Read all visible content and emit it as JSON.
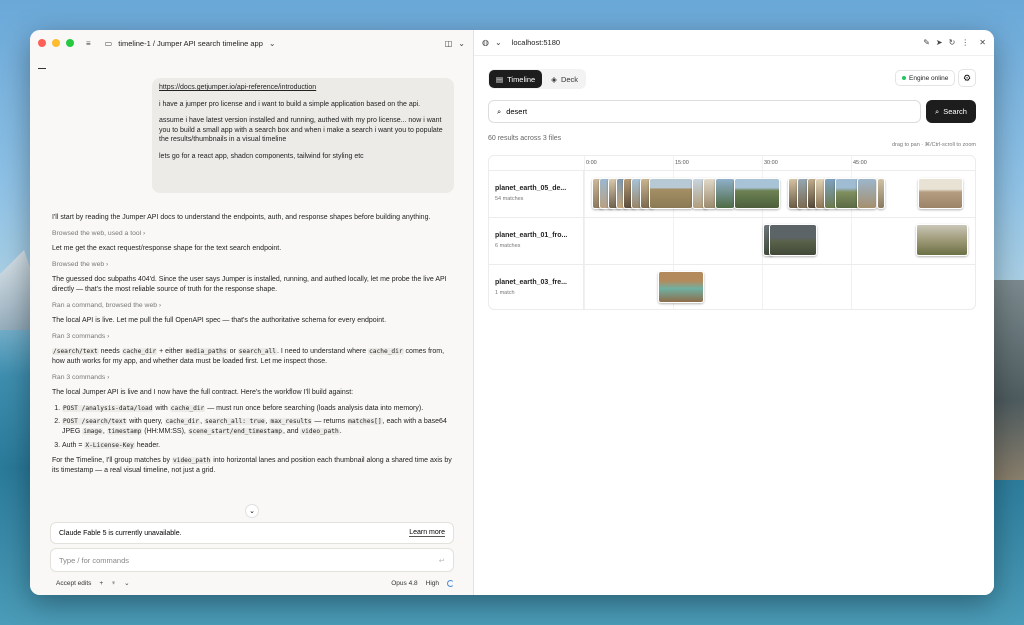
{
  "left": {
    "title": "timeline-1 / Jumper API search timeline app",
    "user_message": {
      "link": "https://docs.getjumper.io/api-reference/introduction",
      "p1": "i have a jumper pro license and i want to build a simple application based on the api.",
      "p2": "assume i have latest version installed and running, authed with my pro license... now i want you to build a small app with a search box and when i make a search i want you to populate the results/thumbnails in a visual timeline",
      "p3": "lets go for a react app, shadcn components, tailwind for styling etc"
    },
    "conversation": {
      "msg1": "I'll start by reading the Jumper API docs to understand the endpoints, auth, and response shapes before building anything.",
      "act1": "Browsed the web, used a tool",
      "msg2": "Let me get the exact request/response shape for the text search endpoint.",
      "act2": "Browsed the web",
      "msg3": "The guessed doc subpaths 404'd. Since the user says Jumper is installed, running, and authed locally, let me probe the live API directly — that's the most reliable source of truth for the response shape.",
      "act3": "Ran a command, browsed the web",
      "msg4": "The local API is live. Let me pull the full OpenAPI spec — that's the authoritative schema for every endpoint.",
      "act4": "Ran 3 commands",
      "msg5": {
        "c1": "/search/text",
        "t1": " needs ",
        "c2": "cache_dir",
        "t2": " + either ",
        "c3": "media_paths",
        "t3": " or ",
        "c4": "search_all",
        "t4": ". I need to understand where ",
        "c5": "cache_dir",
        "t5": " comes from, how auth works for my app, and whether data must be loaded first. Let me inspect those."
      },
      "act5": "Ran 3 commands",
      "msg6": "The local Jumper API is live and I now have the full contract. Here's the workflow I'll build against:",
      "list": {
        "i1": {
          "c1": "POST /analysis-data/load",
          "t1": " with ",
          "c2": "cache_dir",
          "t2": " — must run once before searching (loads analysis data into memory)."
        },
        "i2": {
          "c1": "POST /search/text",
          "t1": " with query, ",
          "c2": "cache_dir",
          "t2": ", ",
          "c3": "search_all: true",
          "t3": ", ",
          "c4": "max_results",
          "t4": " — returns ",
          "c5": "matches[]",
          "t5": ", each with a base64 JPEG ",
          "c6": "image",
          "t6": ", ",
          "c7": "timestamp",
          "t7": " (HH:MM:SS), ",
          "c8": "scene_start/end_timestamp",
          "t8": ", and ",
          "c9": "video_path",
          "t9": "."
        },
        "i3": {
          "t1": "Auth = ",
          "c1": "X-License-Key",
          "t2": " header."
        }
      },
      "msg7": {
        "t1": "For the Timeline, I'll group matches by ",
        "c1": "video_path",
        "t2": " into horizontal lanes and position each thumbnail along a shared time axis by its timestamp — a real visual timeline, not just a grid."
      }
    },
    "notice": {
      "text": "Claude Fable 5 is currently unavailable.",
      "learn_more": "Learn more"
    },
    "input_placeholder": "Type / for commands",
    "bottom": {
      "accept_edits": "Accept edits",
      "model": "Opus 4.8",
      "effort": "High"
    }
  },
  "right": {
    "url": "localhost:5180",
    "tabs": [
      {
        "label": "Timeline"
      },
      {
        "label": "Deck"
      }
    ],
    "engine": "Engine online",
    "search_value": "desert",
    "search_button": "Search",
    "result_count": "60 results across 3 files",
    "hint": "drag to pan · ⌘/Ctrl-scroll to zoom",
    "ticks": [
      "0:00",
      "15:00",
      "30:00",
      "45:00"
    ],
    "lanes": [
      {
        "name": "planet_earth_05_de...",
        "sub": "54 matches"
      },
      {
        "name": "planet_earth_01_fro...",
        "sub": "6 matches"
      },
      {
        "name": "planet_earth_03_fre...",
        "sub": "1 match"
      }
    ],
    "colors": {
      "accent": "#1d1d1d",
      "online": "#22c55e"
    }
  }
}
